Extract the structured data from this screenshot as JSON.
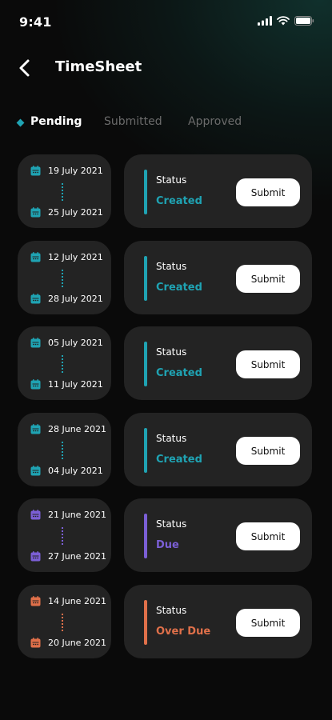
{
  "status_bar": {
    "time": "9:41"
  },
  "header": {
    "title": "TimeSheet"
  },
  "tabs": [
    {
      "label": "Pending",
      "active": true
    },
    {
      "label": "Submitted",
      "active": false
    },
    {
      "label": "Approved",
      "active": false
    }
  ],
  "colors": {
    "accent_created": "#1fa3b3",
    "accent_due": "#7b5fd6",
    "accent_overdue": "#e0704a",
    "card_bg": "#232323",
    "background": "#0a0a0a"
  },
  "status_label": "Status",
  "submit_label": "Submit",
  "timesheets": [
    {
      "start": "19 July 2021",
      "end": "25 July 2021",
      "status": "Created",
      "color": "#1fa3b3"
    },
    {
      "start": "12 July 2021",
      "end": "28 July 2021",
      "status": "Created",
      "color": "#1fa3b3"
    },
    {
      "start": "05 July 2021",
      "end": "11 July 2021",
      "status": "Created",
      "color": "#1fa3b3"
    },
    {
      "start": "28 June 2021",
      "end": "04 July 2021",
      "status": "Created",
      "color": "#1fa3b3"
    },
    {
      "start": "21 June 2021",
      "end": "27 June 2021",
      "status": "Due",
      "color": "#7b5fd6"
    },
    {
      "start": "14 June 2021",
      "end": "20 June 2021",
      "status": "Over Due",
      "color": "#e0704a"
    }
  ]
}
